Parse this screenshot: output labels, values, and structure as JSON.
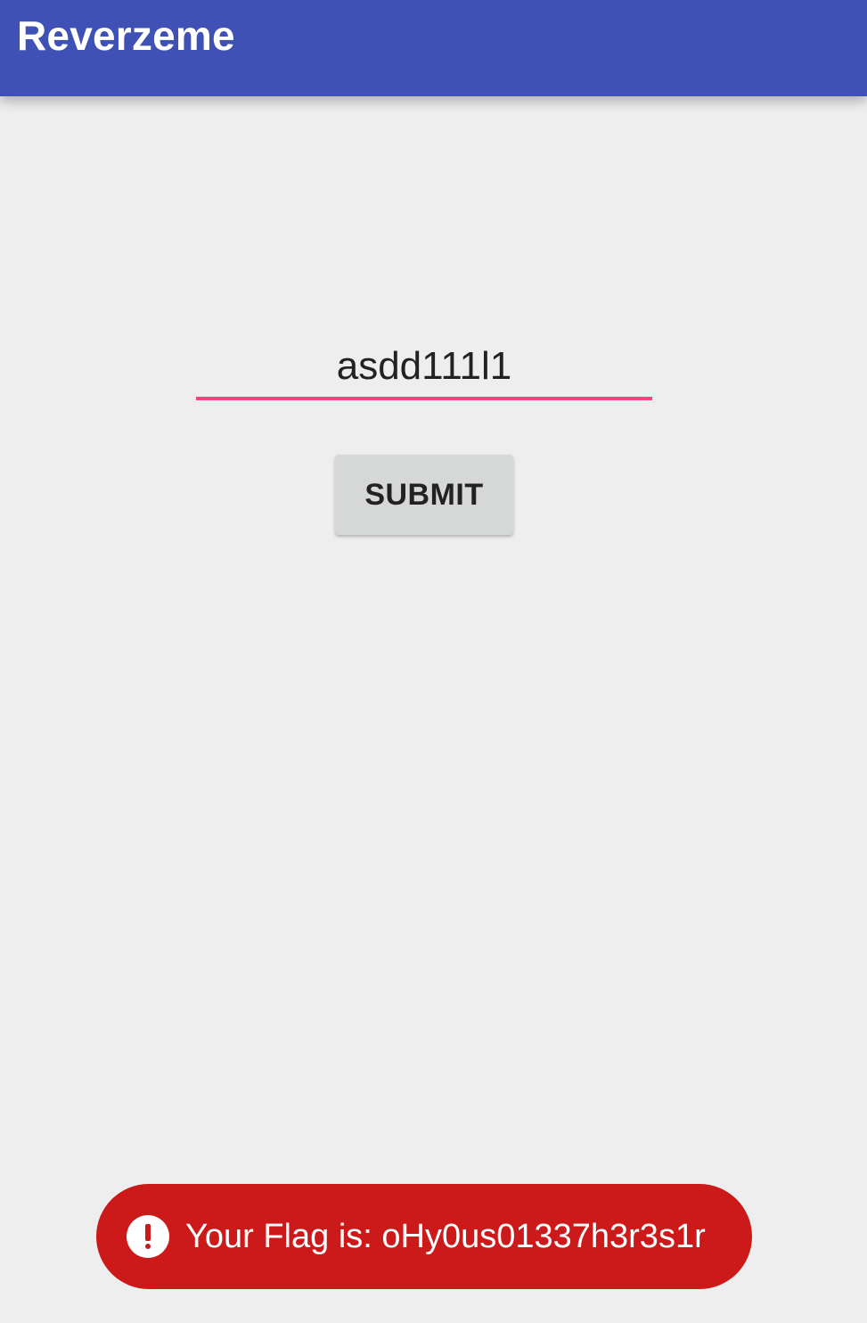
{
  "app_bar": {
    "title": "Reverzeme",
    "color": "#3f51b5"
  },
  "form": {
    "input_value": "asdd111l1",
    "underline_color": "#ff4081",
    "submit_label": "SUBMIT"
  },
  "toast": {
    "icon": "exclamation-circle-icon",
    "message": "Your Flag is: oHy0us01337h3r3s1r",
    "background_color": "#cc1a1a"
  },
  "colors": {
    "background": "#eeeeee"
  }
}
